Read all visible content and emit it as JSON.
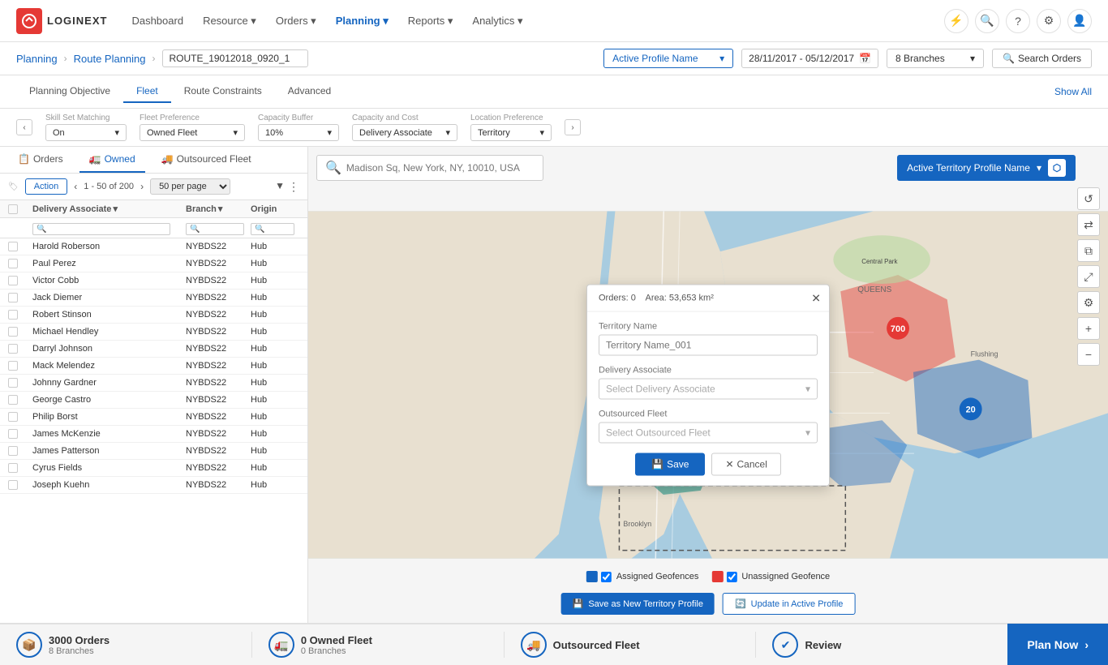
{
  "app": {
    "logo_text": "LOGINEXT",
    "logo_char": "L"
  },
  "nav": {
    "items": [
      {
        "label": "Dashboard",
        "active": false
      },
      {
        "label": "Resource",
        "active": false,
        "has_arrow": true
      },
      {
        "label": "Orders",
        "active": false,
        "has_arrow": true
      },
      {
        "label": "Planning",
        "active": true,
        "has_arrow": true
      },
      {
        "label": "Reports",
        "active": false,
        "has_arrow": true
      },
      {
        "label": "Analytics",
        "active": false,
        "has_arrow": true
      }
    ]
  },
  "breadcrumb": {
    "planning": "Planning",
    "route_planning": "Route Planning",
    "route_name": "ROUTE_19012018_0920_1"
  },
  "toolbar": {
    "profile_name": "Active Profile Name",
    "date_range": "28/11/2017 - 05/12/2017",
    "branches": "8 Branches",
    "search_orders": "Search Orders"
  },
  "filter_tabs": [
    {
      "label": "Planning Objective",
      "active": false
    },
    {
      "label": "Fleet",
      "active": true
    },
    {
      "label": "Route Constraints",
      "active": false
    },
    {
      "label": "Advanced",
      "active": false
    }
  ],
  "show_all": "Show All",
  "settings": {
    "skill_set": {
      "label": "Skill Set Matching",
      "value": "On"
    },
    "fleet_pref": {
      "label": "Fleet Preference",
      "value": "Owned Fleet"
    },
    "capacity_buffer": {
      "label": "Capacity Buffer",
      "value": "10%"
    },
    "capacity_cost": {
      "label": "Capacity and Cost",
      "value": "Delivery Associate"
    },
    "location_pref": {
      "label": "Location Preference",
      "value": "Territory"
    }
  },
  "panel": {
    "tabs": [
      {
        "label": "Orders",
        "icon": "📋",
        "active": false
      },
      {
        "label": "Owned",
        "icon": "🚛",
        "active": true
      },
      {
        "label": "Outsourced Fleet",
        "icon": "🚚",
        "active": false
      }
    ],
    "action_label": "Action",
    "pagination": "1 - 50 of 200",
    "per_page": "50 per page",
    "columns": [
      "Delivery Associate",
      "Branch",
      "Origin"
    ],
    "rows": [
      {
        "da": "Harold Roberson",
        "branch": "NYBDS22",
        "origin": "Hub"
      },
      {
        "da": "Paul Perez",
        "branch": "NYBDS22",
        "origin": "Hub"
      },
      {
        "da": "Victor Cobb",
        "branch": "NYBDS22",
        "origin": "Hub"
      },
      {
        "da": "Jack Diemer",
        "branch": "NYBDS22",
        "origin": "Hub"
      },
      {
        "da": "Robert Stinson",
        "branch": "NYBDS22",
        "origin": "Hub"
      },
      {
        "da": "Michael Hendley",
        "branch": "NYBDS22",
        "origin": "Hub"
      },
      {
        "da": "Darryl Johnson",
        "branch": "NYBDS22",
        "origin": "Hub"
      },
      {
        "da": "Mack Melendez",
        "branch": "NYBDS22",
        "origin": "Hub"
      },
      {
        "da": "Johnny Gardner",
        "branch": "NYBDS22",
        "origin": "Hub"
      },
      {
        "da": "George Castro",
        "branch": "NYBDS22",
        "origin": "Hub"
      },
      {
        "da": "Philip Borst",
        "branch": "NYBDS22",
        "origin": "Hub"
      },
      {
        "da": "James McKenzie",
        "branch": "NYBDS22",
        "origin": "Hub"
      },
      {
        "da": "James Patterson",
        "branch": "NYBDS22",
        "origin": "Hub"
      },
      {
        "da": "Cyrus Fields",
        "branch": "NYBDS22",
        "origin": "Hub"
      },
      {
        "da": "Joseph Kuehn",
        "branch": "NYBDS22",
        "origin": "Hub"
      }
    ]
  },
  "map": {
    "search_placeholder": "Madison Sq, New York, NY, 10010, USA",
    "territory_profile": "Active Territory Profile Name"
  },
  "territory_modal": {
    "orders": "Orders: 0",
    "area": "Area: 53,653 km²",
    "territory_name_label": "Territory Name",
    "territory_name_placeholder": "Territory Name_001",
    "delivery_associate_label": "Delivery Associate",
    "delivery_associate_placeholder": "Select Delivery Associate",
    "outsourced_fleet_label": "Outsourced Fleet",
    "outsourced_fleet_placeholder": "Select Outsourced Fleet",
    "save_label": "Save",
    "cancel_label": "Cancel"
  },
  "map_legend": {
    "assigned": "Assigned Geofences",
    "unassigned": "Unassigned Geofence",
    "assigned_color": "#1565c0",
    "unassigned_color": "#e53935"
  },
  "map_actions": {
    "save_territory": "Save as New Territory Profile",
    "update_active": "Update in Active Profile"
  },
  "bottom_bar": {
    "orders_title": "3000 Orders",
    "orders_subtitle": "8 Branches",
    "owned_fleet_title": "0 Owned Fleet",
    "owned_fleet_subtitle": "0 Branches",
    "outsourced_label": "Outsourced Fleet",
    "review_label": "Review",
    "plan_now": "Plan Now"
  }
}
